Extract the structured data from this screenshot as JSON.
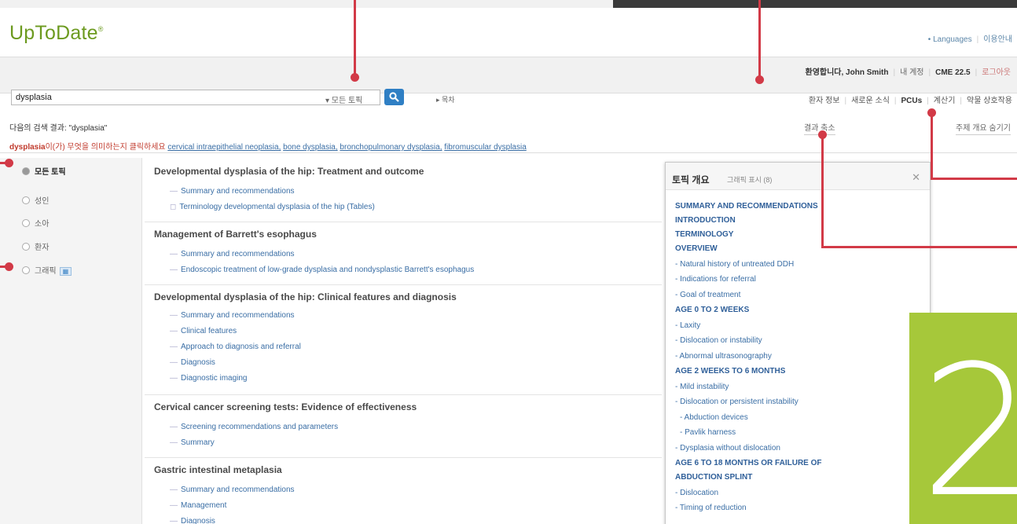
{
  "header": {
    "logo": "UpToDate",
    "logo_mark": "®",
    "languages_link": "• Languages",
    "guide_link": "이용안내"
  },
  "user_bar": {
    "welcome": "환영합니다, John Smith",
    "my_account": "내 계정",
    "cme": "CME 22.5",
    "logout": "로그아웃"
  },
  "search": {
    "value": "dysplasia",
    "scope": "▾ 모든 토픽",
    "toc": "▸ 목차"
  },
  "toolbar": {
    "patient_info": "환자 정보",
    "whats_new": "새로운 소식",
    "pcus": "PCUs",
    "calculators": "계산기",
    "drug_interactions": "약물 상호작용"
  },
  "results_header": "다음의 검색 결과: \"dysplasia\"",
  "shrink_results": "결과 축소",
  "hide_outline": "주제 개요 숨기기",
  "did_you_mean": {
    "term": "dysplasia",
    "question": "이(가) 무엇을 의미하는지 클릭하세요",
    "options": [
      "cervical intraepithelial neoplasia,",
      "bone dysplasia,",
      "bronchopulmonary dysplasia,",
      "fibromuscular dysplasia"
    ]
  },
  "sidebar": {
    "items": [
      {
        "label": "모든 토픽"
      },
      {
        "label": "성인"
      },
      {
        "label": "소아"
      },
      {
        "label": "환자"
      },
      {
        "label": "그래픽"
      }
    ]
  },
  "results": [
    {
      "title": "Developmental dysplasia of the hip: Treatment and outcome",
      "links": [
        "Summary and recommendations",
        "Terminology developmental dysplasia of the hip (Tables)"
      ]
    },
    {
      "title": "Management of Barrett's esophagus",
      "links": [
        "Summary and recommendations",
        "Endoscopic treatment of low-grade dysplasia and nondysplastic Barrett's esophagus"
      ]
    },
    {
      "title": "Developmental dysplasia of the hip: Clinical features and diagnosis",
      "links": [
        "Summary and recommendations",
        "Clinical features",
        "Approach to diagnosis and referral",
        "Diagnosis",
        "Diagnostic imaging"
      ]
    },
    {
      "title": "Cervical cancer screening tests: Evidence of effectiveness",
      "links": [
        "Screening recommendations and parameters",
        "Summary"
      ]
    },
    {
      "title": "Gastric intestinal metaplasia",
      "links": [
        "Summary and recommendations",
        "Management",
        "Diagnosis"
      ]
    }
  ],
  "outline": {
    "title": "토픽 개요",
    "subtitle": "그래픽 표시 (8)",
    "items": [
      {
        "text": "SUMMARY AND RECOMMENDATIONS",
        "kind": "h"
      },
      {
        "text": "INTRODUCTION",
        "kind": "h"
      },
      {
        "text": "TERMINOLOGY",
        "kind": "h"
      },
      {
        "text": "OVERVIEW",
        "kind": "h"
      },
      {
        "text": "- Natural history of untreated DDH",
        "kind": "i"
      },
      {
        "text": "- Indications for referral",
        "kind": "i"
      },
      {
        "text": "- Goal of treatment",
        "kind": "i"
      },
      {
        "text": "AGE 0 TO 2 WEEKS",
        "kind": "h"
      },
      {
        "text": "- Laxity",
        "kind": "i"
      },
      {
        "text": "- Dislocation or instability",
        "kind": "i"
      },
      {
        "text": "- Abnormal ultrasonography",
        "kind": "i"
      },
      {
        "text": "AGE 2 WEEKS TO 6 MONTHS",
        "kind": "h"
      },
      {
        "text": "- Mild instability",
        "kind": "i"
      },
      {
        "text": "- Dislocation or persistent instability",
        "kind": "i"
      },
      {
        "text": "- Abduction devices",
        "kind": "i2"
      },
      {
        "text": "- Pavlik harness",
        "kind": "i2"
      },
      {
        "text": "- Dysplasia without dislocation",
        "kind": "i"
      },
      {
        "text": "AGE 6 TO 18 MONTHS OR FAILURE OF",
        "kind": "h"
      },
      {
        "text": "ABDUCTION SPLINT",
        "kind": "h"
      },
      {
        "text": "- Dislocation",
        "kind": "i"
      },
      {
        "text": "- Timing of reduction",
        "kind": "i"
      }
    ]
  },
  "step_number": "2",
  "colors": {
    "brand": "#6c9a1f",
    "accent": "#2f7fc4",
    "callout": "#d23a47",
    "panel_green": "#a6c83a"
  }
}
